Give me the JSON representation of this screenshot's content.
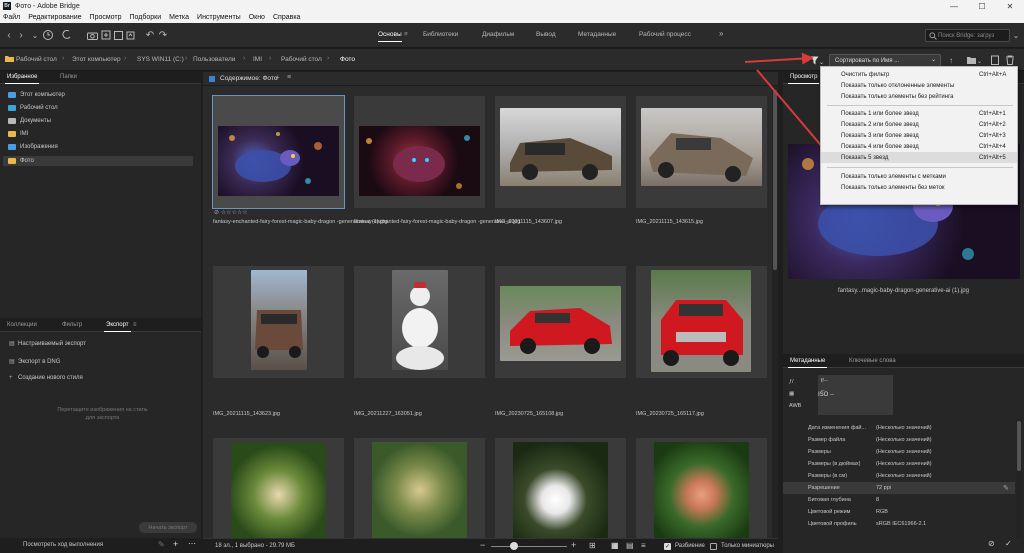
{
  "window": {
    "title": "Фото - Adobe Bridge",
    "app_icon": "Br",
    "min": "—",
    "max": "☐",
    "close": "✕"
  },
  "menu": [
    "Файл",
    "Редактирование",
    "Просмотр",
    "Подборки",
    "Метка",
    "Инструменты",
    "Окно",
    "Справка"
  ],
  "workspaces": {
    "active": "Основы",
    "items": [
      "Библиотеки",
      "Диафильм",
      "Вывод",
      "Метаданные",
      "Рабочий процесс"
    ]
  },
  "search": {
    "placeholder": "Поиск Bridge: загруз"
  },
  "breadcrumb": [
    "Рабочий стол",
    "Этот компьютер",
    "SYS WIN11 (C:)",
    "Пользователи",
    "IMI",
    "Рабочий стол",
    "Фото"
  ],
  "sort": {
    "label": "Сортировать по Имя ..."
  },
  "favorites": {
    "tabs": [
      "Избранное",
      "Папки"
    ],
    "items": [
      {
        "label": "Этот компьютер",
        "color": "#4a9de0"
      },
      {
        "label": "Рабочий стол",
        "color": "#3aa6d8"
      },
      {
        "label": "Документы",
        "color": "#b8b8b8"
      },
      {
        "label": "IMI",
        "color": "#e8b84a"
      },
      {
        "label": "Изображения",
        "color": "#4a9de0"
      },
      {
        "label": "Фото",
        "color": "#e8b84a"
      }
    ]
  },
  "export": {
    "tabs": [
      "Коллекции",
      "Фильтр",
      "Экспорт"
    ],
    "items": [
      "Настраиваемый экспорт",
      "Экспорт в DNG",
      "Создание нового стиля"
    ],
    "hint": "Перетащите изображения на стиль для экспорта",
    "start_button": "Начать экспорт",
    "progress_link": "Посмотреть ход выполнения"
  },
  "content": {
    "title": "Содержимое: Фото",
    "stars": "☆☆☆☆☆",
    "files": [
      "fantasy-enchanted-fairy-forest-magic-baby-dragon -generative-ai (1).jpg",
      "fantasy-enchanted-fairy-forest-magic-baby-dragon -generative-ai.jpg",
      "IMG_20211115_143607.jpg",
      "IMG_20211115_143615.jpg",
      "IMG_20211115_143623.jpg",
      "IMG_20211227_163051.jpg",
      "IMG_20230725_165108.jpg",
      "IMG_20230725_165117.jpg",
      "",
      "",
      "",
      ""
    ]
  },
  "status": {
    "count": "18 эл., 1 выбрано - 29.79 МБ",
    "unwrap": "Разбиение",
    "thumbs_only": "Только миниатюры"
  },
  "preview": {
    "tab": "Просмотр",
    "caption": "fantasy...magic-baby-dragon-generative-ai (1).jpg"
  },
  "metadata": {
    "tabs": [
      "Метаданные",
      "Ключевые слова"
    ],
    "exposure": {
      "aperture": "f/--",
      "shutter": "--",
      "iso": "ISO --"
    },
    "rows": [
      {
        "k": "Дата изменения фай...",
        "v": "(Несколько значений)"
      },
      {
        "k": "Размер файла",
        "v": "(Несколько значений)"
      },
      {
        "k": "Размеры",
        "v": "(Несколько значений)"
      },
      {
        "k": "Размеры (в дюймах)",
        "v": "(Несколько значений)"
      },
      {
        "k": "Размеры (в см)",
        "v": "(Несколько значений)"
      },
      {
        "k": "Разрешение",
        "v": "72 ppi"
      },
      {
        "k": "Битовая глубина",
        "v": "8"
      },
      {
        "k": "Цветовой режим",
        "v": "RGB"
      },
      {
        "k": "Цветовой профиль",
        "v": "sRGB IEC61966-2.1"
      }
    ]
  },
  "filter_menu": [
    {
      "label": "Очистить фильтр",
      "shortcut": "Ctrl+Alt+A"
    },
    {
      "label": "Показать только отклоненные элементы",
      "shortcut": ""
    },
    {
      "label": "Показать только элементы без рейтинга",
      "shortcut": ""
    },
    {
      "label": "Показать 1 или более звезд",
      "shortcut": "Ctrl+Alt+1"
    },
    {
      "label": "Показать 2 или более звезд",
      "shortcut": "Ctrl+Alt+2"
    },
    {
      "label": "Показать 3 или более звезд",
      "shortcut": "Ctrl+Alt+3"
    },
    {
      "label": "Показать 4 или более звезд",
      "shortcut": "Ctrl+Alt+4"
    },
    {
      "label": "Показать 5 звезд",
      "shortcut": "Ctrl+Alt+5"
    },
    {
      "label": "Показать только элементы с метками",
      "shortcut": ""
    },
    {
      "label": "Показать только элементы без меток",
      "shortcut": ""
    }
  ],
  "colors": {
    "accent": "#6b93c8",
    "arrow": "#d93a3a"
  }
}
